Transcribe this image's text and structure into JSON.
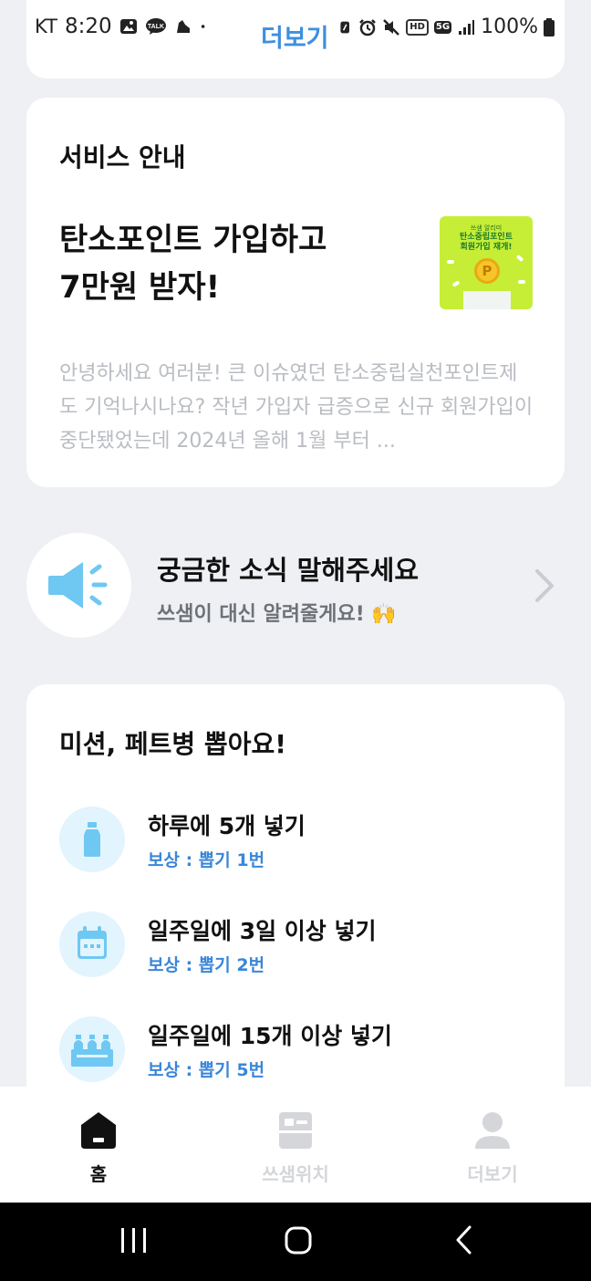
{
  "status_bar": {
    "carrier": "KT",
    "time": "8:20",
    "left_icons": [
      "gallery-icon",
      "kakaotalk-icon",
      "shoe-icon",
      "dot-icon"
    ],
    "kakao_badge": "TALK",
    "overlay_link": "더보기",
    "right_icons": [
      "nfc-icon",
      "alarm-icon",
      "mute-icon",
      "hd-icon",
      "5g-icon",
      "signal-icon",
      "battery-icon"
    ],
    "hd_label": "HD",
    "network_label": "5G",
    "battery": "100%"
  },
  "service_card": {
    "heading": "서비스 안내",
    "headline_line1": "탄소포인트 가입하고",
    "headline_line2": "7만원 받자!",
    "thumbnail": {
      "small_text": "쓰샘 알리미",
      "title_line1": "탄소중립포인트",
      "title_line2": "회원가입 재개!",
      "coin_letter": "P",
      "bg_color": "#c6ee36"
    },
    "body_text": "안녕하세요 여러분! 큰 이슈였던 탄소중립실천포인트제도 기억나시나요? 작년 가입자 급증으로 신규 회원가입이 중단됐었는데 2024년 올해 1월 부터 ..."
  },
  "news_banner": {
    "icon": "megaphone-icon",
    "title": "궁금한 소식 말해주세요",
    "subtitle": "쓰샘이 대신 알려줄게요! 🙌",
    "chevron": "chevron-right-icon"
  },
  "missions": {
    "heading": "미션, 페트병 뽑아요!",
    "items": [
      {
        "title": "하루에 5개 넣기",
        "reward": "보상 : 뽑기 1번",
        "icon": "bottle-icon"
      },
      {
        "title": "일주일에 3일 이상 넣기",
        "reward": "보상 : 뽑기 2번",
        "icon": "calendar-icon"
      },
      {
        "title": "일주일에 15개 이상 넣기",
        "reward": "보상 : 뽑기 5번",
        "icon": "bottles-pack-icon"
      }
    ]
  },
  "tab_bar": {
    "tabs": [
      {
        "label": "홈",
        "icon": "home-icon",
        "active": true
      },
      {
        "label": "쓰샘위치",
        "icon": "location-icon",
        "active": false
      },
      {
        "label": "더보기",
        "icon": "profile-icon",
        "active": false
      }
    ]
  },
  "colors": {
    "accent_blue": "#3a86d9",
    "icon_blue": "#6ec8f2",
    "icon_circle_bg": "#e2f4fd",
    "page_bg": "#eef0f3",
    "inactive_tab": "#d4d6da"
  }
}
